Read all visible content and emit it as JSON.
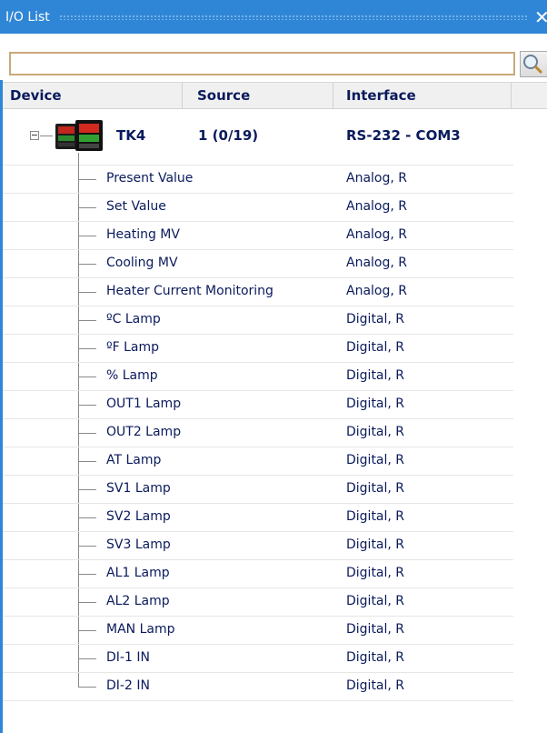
{
  "window": {
    "title": "I/O List",
    "close_glyph": "✕"
  },
  "search": {
    "value": "",
    "placeholder": ""
  },
  "columns": {
    "device": "Device",
    "source": "Source",
    "interface": "Interface"
  },
  "device": {
    "name": "TK4",
    "source": "1 (0/19)",
    "interface": "RS-232 - COM3",
    "expanded": true
  },
  "items": [
    {
      "name": "Present Value",
      "interface": "Analog, R"
    },
    {
      "name": "Set Value",
      "interface": "Analog, R"
    },
    {
      "name": "Heating MV",
      "interface": "Analog, R"
    },
    {
      "name": "Cooling MV",
      "interface": "Analog, R"
    },
    {
      "name": "Heater Current Monitoring",
      "interface": "Analog, R"
    },
    {
      "name": "ºC Lamp",
      "interface": "Digital, R"
    },
    {
      "name": "ºF Lamp",
      "interface": "Digital, R"
    },
    {
      "name": "% Lamp",
      "interface": "Digital, R"
    },
    {
      "name": "OUT1 Lamp",
      "interface": "Digital, R"
    },
    {
      "name": "OUT2 Lamp",
      "interface": "Digital, R"
    },
    {
      "name": "AT Lamp",
      "interface": "Digital, R"
    },
    {
      "name": "SV1 Lamp",
      "interface": "Digital, R"
    },
    {
      "name": "SV2 Lamp",
      "interface": "Digital, R"
    },
    {
      "name": "SV3 Lamp",
      "interface": "Digital, R"
    },
    {
      "name": "AL1 Lamp",
      "interface": "Digital, R"
    },
    {
      "name": "AL2 Lamp",
      "interface": "Digital, R"
    },
    {
      "name": "MAN Lamp",
      "interface": "Digital, R"
    },
    {
      "name": "DI-1 IN",
      "interface": "Digital, R"
    },
    {
      "name": "DI-2 IN",
      "interface": "Digital, R"
    }
  ],
  "icons": {
    "search": "search-icon",
    "device": "temperature-controller-icon",
    "expander": "collapse-icon"
  }
}
